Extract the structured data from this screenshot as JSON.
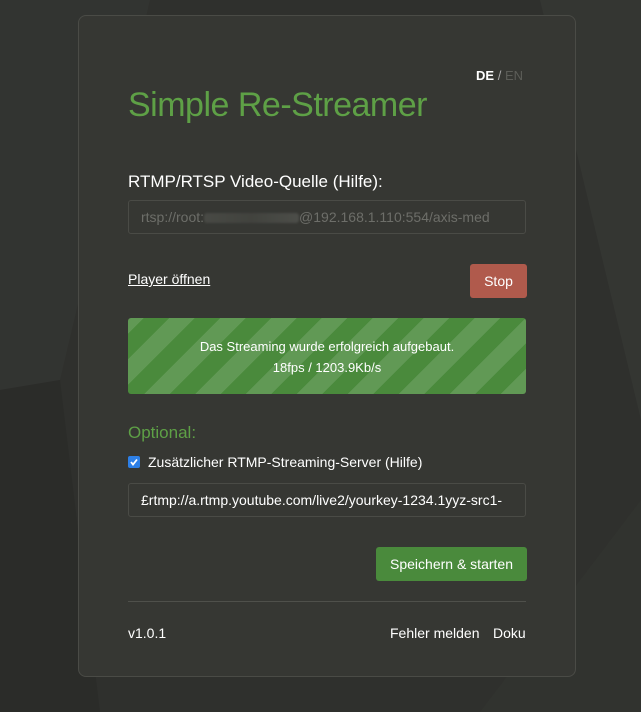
{
  "header": {
    "lang_active": "DE",
    "lang_separator": "/",
    "lang_inactive": "EN",
    "title": "Simple Re-Streamer"
  },
  "source": {
    "label": "RTMP/RTSP Video-Quelle (Hilfe):",
    "value_prefix": "rtsp://root:",
    "value_suffix": "@192.168.1.110:554/axis-med"
  },
  "player": {
    "open_link": "Player öffnen",
    "stop_label": "Stop"
  },
  "status": {
    "message": "Das Streaming wurde erfolgreich aufgebaut.",
    "stats": "18fps / 1203.9Kb/s"
  },
  "optional": {
    "heading": "Optional:",
    "checkbox_label": "Zusätzlicher RTMP-Streaming-Server (Hilfe)",
    "checkbox_checked": true,
    "rtmp_value": "£rtmp://a.rtmp.youtube.com/live2/yourkey-1234.1yyz-src1-",
    "save_label": "Speichern & starten"
  },
  "footer": {
    "version": "v1.0.1",
    "report_label": "Fehler melden",
    "docs_label": "Doku"
  },
  "colors": {
    "accent_green": "#5ea046",
    "button_green": "#4a8a3c",
    "stop_red": "#b05a4c",
    "background": "#2f302d",
    "panel": "#363733"
  }
}
